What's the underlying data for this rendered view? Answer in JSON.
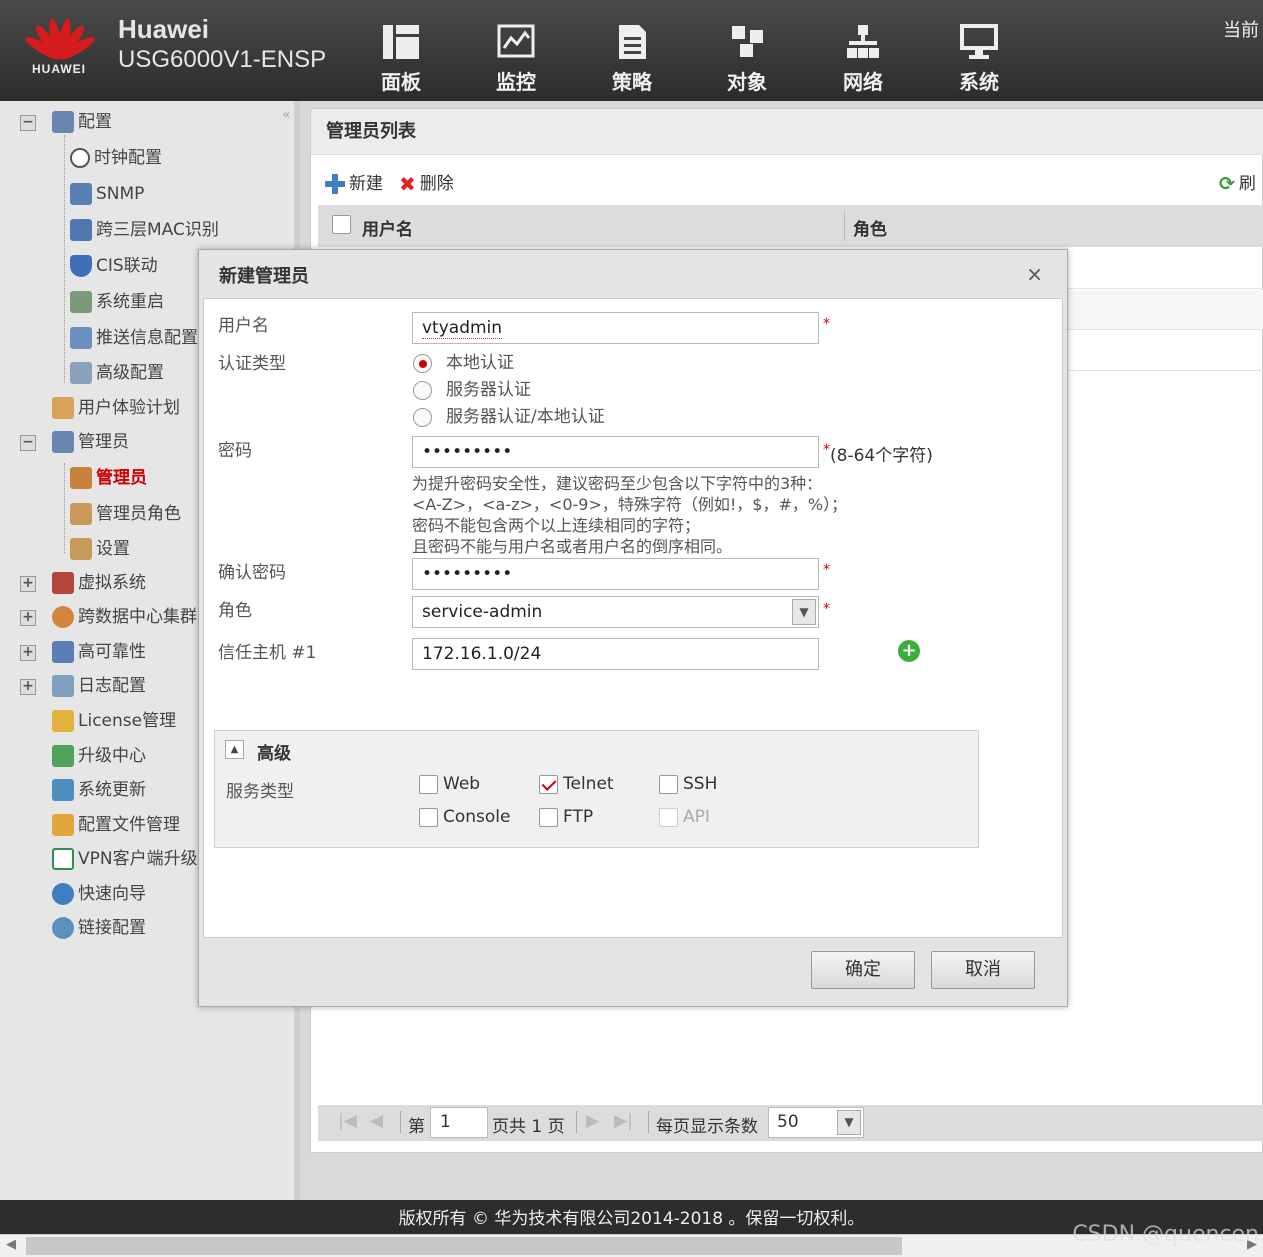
{
  "header": {
    "brand_logo_text": "HUAWEI",
    "product_name": "Huawei",
    "product_model": "USG6000V1-ENSP",
    "top_right_text": "当前",
    "nav": [
      {
        "label": "面板",
        "icon": "dashboard-icon"
      },
      {
        "label": "监控",
        "icon": "monitor-icon"
      },
      {
        "label": "策略",
        "icon": "policy-icon"
      },
      {
        "label": "对象",
        "icon": "object-icon"
      },
      {
        "label": "网络",
        "icon": "network-icon"
      },
      {
        "label": "系统",
        "icon": "system-icon"
      }
    ]
  },
  "sidebar": {
    "collapse_glyph": "«",
    "items": [
      {
        "label": "配置",
        "icon": "config-icon",
        "expander": "−"
      },
      {
        "label": "时钟配置",
        "icon": "clock-icon"
      },
      {
        "label": "SNMP",
        "icon": "snmp-icon"
      },
      {
        "label": "跨三层MAC识别",
        "icon": "mac-icon"
      },
      {
        "label": "CIS联动",
        "icon": "cis-shield-icon"
      },
      {
        "label": "系统重启",
        "icon": "restart-icon"
      },
      {
        "label": "推送信息配置",
        "icon": "push-icon"
      },
      {
        "label": "高级配置",
        "icon": "advanced-icon"
      },
      {
        "label": "用户体验计划",
        "icon": "user-exp-icon"
      },
      {
        "label": "管理员",
        "icon": "admin-group-icon",
        "expander": "−"
      },
      {
        "label": "管理员",
        "icon": "admin-icon",
        "selected": true
      },
      {
        "label": "管理员角色",
        "icon": "admin-role-icon"
      },
      {
        "label": "设置",
        "icon": "settings-icon"
      },
      {
        "label": "虚拟系统",
        "icon": "vsys-icon",
        "expander": "+"
      },
      {
        "label": "跨数据中心集群",
        "icon": "datacenter-icon",
        "expander": "+"
      },
      {
        "label": "高可靠性",
        "icon": "ha-icon",
        "expander": "+"
      },
      {
        "label": "日志配置",
        "icon": "log-icon",
        "expander": "+"
      },
      {
        "label": "License管理",
        "icon": "license-icon"
      },
      {
        "label": "升级中心",
        "icon": "upgrade-icon"
      },
      {
        "label": "系统更新",
        "icon": "update-icon"
      },
      {
        "label": "配置文件管理",
        "icon": "config-file-icon"
      },
      {
        "label": "VPN客户端升级",
        "icon": "vpn-icon"
      },
      {
        "label": "快速向导",
        "icon": "wizard-icon"
      },
      {
        "label": "链接配置",
        "icon": "link-icon"
      }
    ]
  },
  "main": {
    "title": "管理员列表",
    "toolbar": {
      "new_label": "新建",
      "delete_label": "删除",
      "refresh_label": "刷"
    },
    "columns": [
      "用户名",
      "角色"
    ],
    "pager": {
      "prefix": "第",
      "page": "1",
      "total": "页共 1 页",
      "per_page_label": "每页显示条数",
      "per_page": "50"
    }
  },
  "dialog": {
    "title": "新建管理员",
    "close_glyph": "×",
    "username_label": "用户名",
    "username_value": "vtyadmin",
    "auth_label": "认证类型",
    "auth_options": [
      "本地认证",
      "服务器认证",
      "服务器认证/本地认证"
    ],
    "auth_selected": 0,
    "password_label": "密码",
    "password_value": "•••••••••",
    "password_length_hint": "(8-64个字符)",
    "password_hints": [
      "为提升密码安全性，建议密码至少包含以下字符中的3种：",
      "<A-Z>，<a-z>，<0-9>，特殊字符（例如!，$，#，%）；",
      "密码不能包含两个以上连续相同的字符；",
      "且密码不能与用户名或者用户名的倒序相同。"
    ],
    "confirm_label": "确认密码",
    "confirm_value": "•••••••••",
    "role_label": "角色",
    "role_value": "service-admin",
    "trusted_host_label": "信任主机 #1",
    "trusted_host_value": "172.16.1.0/24",
    "required_mark": "*",
    "advanced": {
      "title": "高级",
      "collapse_glyph": "▲",
      "service_label": "服务类型",
      "services": [
        {
          "label": "Web",
          "checked": false,
          "disabled": false
        },
        {
          "label": "Telnet",
          "checked": true,
          "disabled": false
        },
        {
          "label": "SSH",
          "checked": false,
          "disabled": false
        },
        {
          "label": "Console",
          "checked": false,
          "disabled": false
        },
        {
          "label": "FTP",
          "checked": false,
          "disabled": false
        },
        {
          "label": "API",
          "checked": false,
          "disabled": true
        }
      ]
    },
    "ok_label": "确定",
    "cancel_label": "取消"
  },
  "footer": {
    "copyright": "版权所有 © 华为技术有限公司2014-2018 。保留一切权利。",
    "watermark": "CSDN @quencen"
  },
  "colors": {
    "accent_red": "#cc0000",
    "header_bg": "#333333",
    "add_green": "#3cae3c"
  }
}
